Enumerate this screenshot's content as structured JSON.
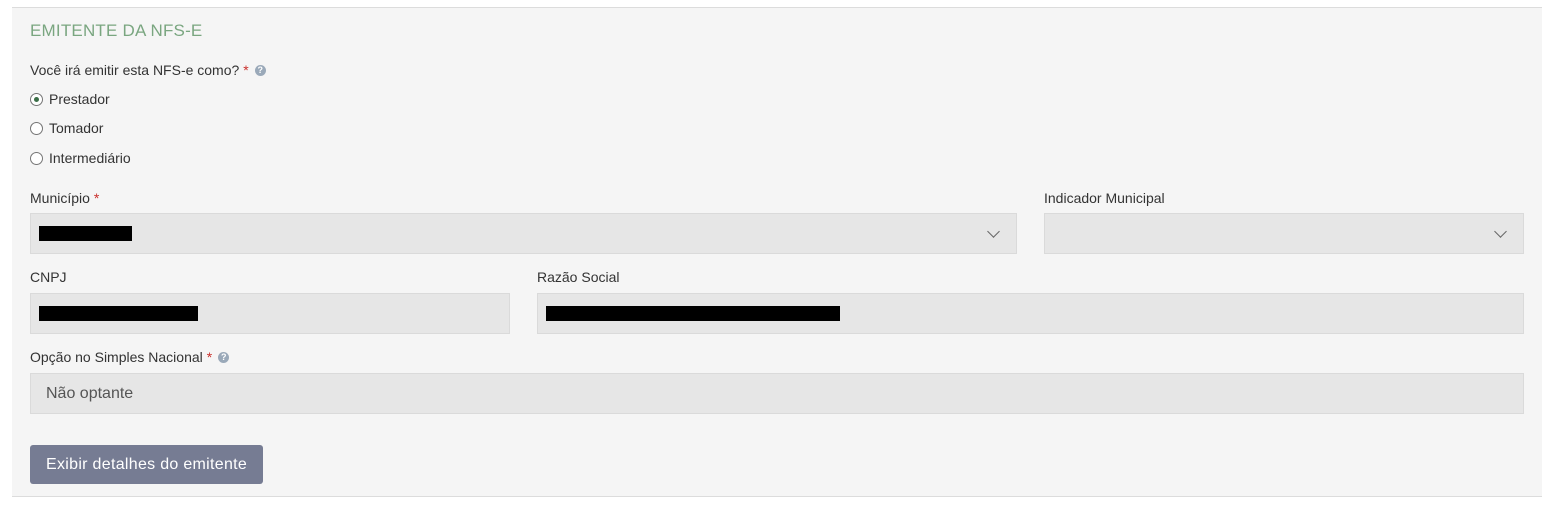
{
  "section": {
    "title": "EMITENTE DA NFS-E"
  },
  "emission_role": {
    "question": "Você irá emitir esta NFS-e como?",
    "required_mark": "*",
    "options": [
      {
        "label": "Prestador",
        "selected": true
      },
      {
        "label": "Tomador",
        "selected": false
      },
      {
        "label": "Intermediário",
        "selected": false
      }
    ]
  },
  "municipio": {
    "label": "Município",
    "required_mark": "*",
    "value": "[redacted]"
  },
  "indicador_municipal": {
    "label": "Indicador Municipal",
    "value": ""
  },
  "cnpj": {
    "label": "CNPJ",
    "value": "[redacted]"
  },
  "razao_social": {
    "label": "Razão Social",
    "value": "[redacted]"
  },
  "simples_nacional": {
    "label": "Opção no Simples Nacional",
    "required_mark": "*",
    "value": "Não optante"
  },
  "actions": {
    "details_button": "Exibir detalhes do emitente"
  },
  "icons": {
    "help": "question-circle-icon",
    "select": "chevron-down-icon"
  },
  "colors": {
    "section_title": "#7aa680",
    "required": "#c9302c",
    "button_bg": "#767c93",
    "field_bg": "#e6e6e6",
    "panel_bg": "#f5f5f5"
  }
}
